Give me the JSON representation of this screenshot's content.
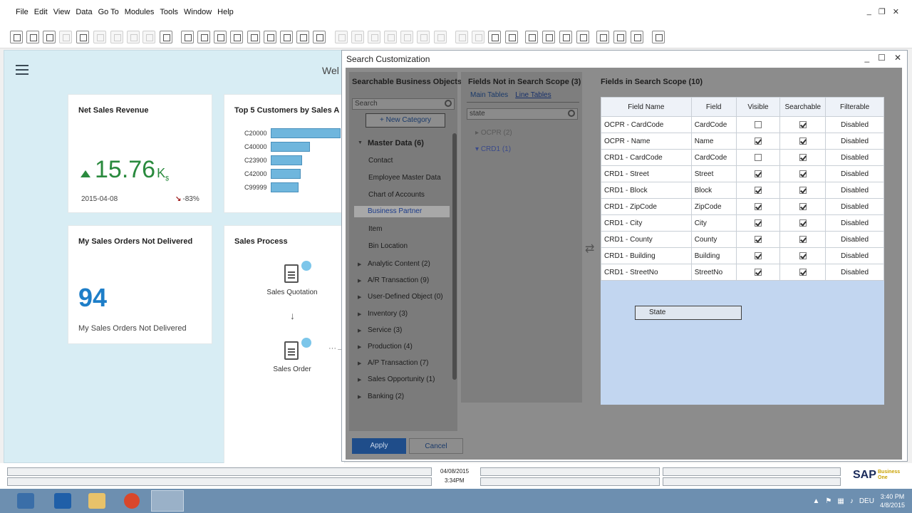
{
  "menu": [
    "File",
    "Edit",
    "View",
    "Data",
    "Go To",
    "Modules",
    "Tools",
    "Window",
    "Help"
  ],
  "window_controls": [
    "_",
    "❐",
    "✕"
  ],
  "cockpit": {
    "welcome": "Wel",
    "net_sales": {
      "title": "Net Sales Revenue",
      "value": "15.76",
      "unit": "K",
      "unit_sub": "$",
      "date": "2015-04-08",
      "delta": "-83%"
    },
    "top_customers": {
      "title": "Top 5 Customers by Sales A",
      "customers": [
        {
          "code": "C20000",
          "value": 100
        },
        {
          "code": "C40000",
          "value": 56
        },
        {
          "code": "C23900",
          "value": 45
        },
        {
          "code": "C42000",
          "value": 43
        },
        {
          "code": "C99999",
          "value": 40
        }
      ]
    },
    "orders_not_delivered": {
      "title": "My Sales Orders Not Delivered",
      "value": "94",
      "caption": "My Sales Orders Not Delivered"
    },
    "sales_process": {
      "title": "Sales Process",
      "steps": [
        "Sales Quotation",
        "Sales Order"
      ]
    }
  },
  "dialog": {
    "title": "Search Customization",
    "controls": [
      "_",
      "☐",
      "✕"
    ],
    "objects": {
      "header": "Searchable Business Objects",
      "search_placeholder": "Search",
      "new_category": "+ New Category",
      "master_data": "Master Data (6)",
      "master_items": [
        "Contact",
        "Employee Master Data",
        "Chart of Accounts",
        "Business Partner",
        "Item",
        "Bin Location"
      ],
      "categories": [
        "Analytic Content (2)",
        "A/R Transaction (9)",
        "User-Defined Object (0)",
        "Inventory (3)",
        "Service (3)",
        "Production (4)",
        "A/P Transaction (7)",
        "Sales Opportunity (1)",
        "Banking (2)"
      ]
    },
    "not_in_scope": {
      "header": "Fields Not in Search Scope (3)",
      "tabs": [
        "Main Tables",
        "Line Tables"
      ],
      "search_value": "state",
      "tree": [
        "OCPR (2)",
        "CRD1 (1)"
      ]
    },
    "in_scope": {
      "header": "Fields in Search Scope (10)",
      "columns": [
        "Field Name",
        "Field",
        "Visible",
        "Searchable",
        "Filterable"
      ],
      "rows": [
        {
          "name": "OCPR - CardCode",
          "field": "CardCode",
          "visible": false,
          "searchable": true,
          "filterable": "Disabled"
        },
        {
          "name": "OCPR - Name",
          "field": "Name",
          "visible": true,
          "searchable": true,
          "filterable": "Disabled"
        },
        {
          "name": "CRD1 - CardCode",
          "field": "CardCode",
          "visible": false,
          "searchable": true,
          "filterable": "Disabled"
        },
        {
          "name": "CRD1 - Street",
          "field": "Street",
          "visible": true,
          "searchable": true,
          "filterable": "Disabled"
        },
        {
          "name": "CRD1 - Block",
          "field": "Block",
          "visible": true,
          "searchable": true,
          "filterable": "Disabled"
        },
        {
          "name": "CRD1 - ZipCode",
          "field": "ZipCode",
          "visible": true,
          "searchable": true,
          "filterable": "Disabled"
        },
        {
          "name": "CRD1 - City",
          "field": "City",
          "visible": true,
          "searchable": true,
          "filterable": "Disabled"
        },
        {
          "name": "CRD1 - County",
          "field": "County",
          "visible": true,
          "searchable": true,
          "filterable": "Disabled"
        },
        {
          "name": "CRD1 - Building",
          "field": "Building",
          "visible": true,
          "searchable": true,
          "filterable": "Disabled"
        },
        {
          "name": "CRD1 - StreetNo",
          "field": "StreetNo",
          "visible": true,
          "searchable": true,
          "filterable": "Disabled"
        }
      ],
      "drag_item": "State"
    },
    "apply": "Apply",
    "cancel": "Cancel"
  },
  "status": {
    "date": "04/08/2015",
    "time": "3:34PM",
    "logo": "SAP",
    "logo_sub": "Business One"
  },
  "taskbar": {
    "lang": "DEU",
    "time": "3:40 PM",
    "date": "4/8/2015"
  }
}
